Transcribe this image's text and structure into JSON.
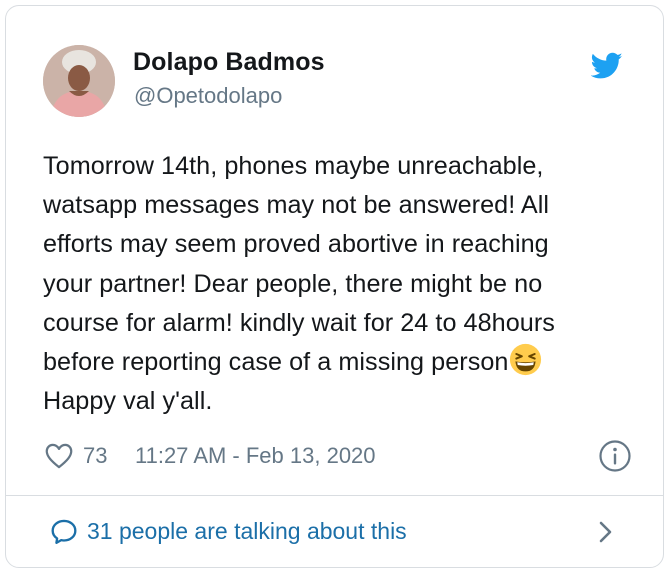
{
  "user": {
    "display_name": "Dolapo Badmos",
    "handle": "@Opetodolapo",
    "avatar_icon": "profile-photo"
  },
  "tweet": {
    "lines": [
      "Tomorrow 14th, phones maybe unreachable,",
      "watsapp messages may not be answered! All",
      "efforts may seem proved abortive in reaching",
      "your partner! Dear people, there might be no",
      "course for alarm! kindly wait for 24 to 48hours",
      "before reporting case of a missing person"
    ],
    "emoji": "grinning-squinting-face",
    "last_line": "Happy val y'all."
  },
  "meta": {
    "like_count": "73",
    "timestamp": "11:27 AM - Feb 13, 2020"
  },
  "footer": {
    "talking_text": "31 people are talking about this"
  },
  "colors": {
    "twitter_blue": "#1da1f2",
    "link_blue": "#1b6fa8",
    "muted_gray": "#657786",
    "border": "#d9dde1"
  }
}
